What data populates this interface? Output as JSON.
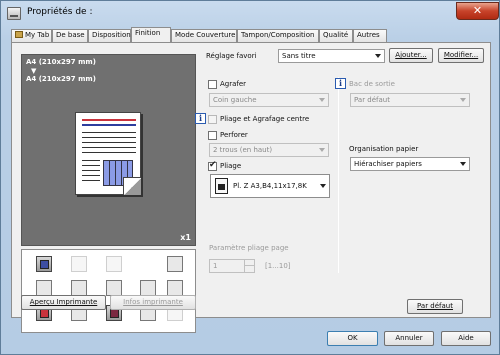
{
  "window": {
    "title": "Propriétés de :",
    "close_label": "✕"
  },
  "tabs": [
    {
      "label": "My Tab",
      "has_icon": true
    },
    {
      "label": "De base"
    },
    {
      "label": "Disposition"
    },
    {
      "label": "Finition",
      "active": true
    },
    {
      "label": "Mode Couverture"
    },
    {
      "label": "Tampon/Composition"
    },
    {
      "label": "Qualité"
    },
    {
      "label": "Autres"
    }
  ],
  "preview": {
    "original_size": "A4 (210x297 mm)",
    "arrow": "▼",
    "output_size": "A4 (210x297 mm)",
    "copies": "x1"
  },
  "left_buttons": {
    "print_preview": "Aperçu Imprimante",
    "printer_info": "Infos imprimante"
  },
  "favorites": {
    "label": "Réglage favori",
    "value": "Sans titre",
    "add_label": "Ajouter...",
    "modify_label": "Modifier..."
  },
  "staple": {
    "label": "Agrafer",
    "checked": false,
    "value": "Coin gauche"
  },
  "fold_staple_center": {
    "label": "Pliage et Agrafage centre"
  },
  "punch": {
    "label": "Perforer",
    "checked": false,
    "value": "2 trous (en haut)"
  },
  "fold": {
    "label": "Pliage",
    "checked": true,
    "value": "Pl. Z A3,B4,11x17,8K"
  },
  "fold_page_param": {
    "label": "Paramètre pliage page",
    "value": "1",
    "range": "[1...10]"
  },
  "output_tray": {
    "label": "Bac de sortie",
    "value": "Par défaut"
  },
  "paper_arrangement": {
    "label": "Organisation papier",
    "value": "Hiérachiser papiers"
  },
  "default_button": "Par défaut",
  "dialog_buttons": {
    "ok": "OK",
    "cancel": "Annuler",
    "help": "Aide"
  },
  "colors": {
    "window_frame": "#b9cfe6",
    "preview_bg": "#707070",
    "close": "#c7432a"
  }
}
